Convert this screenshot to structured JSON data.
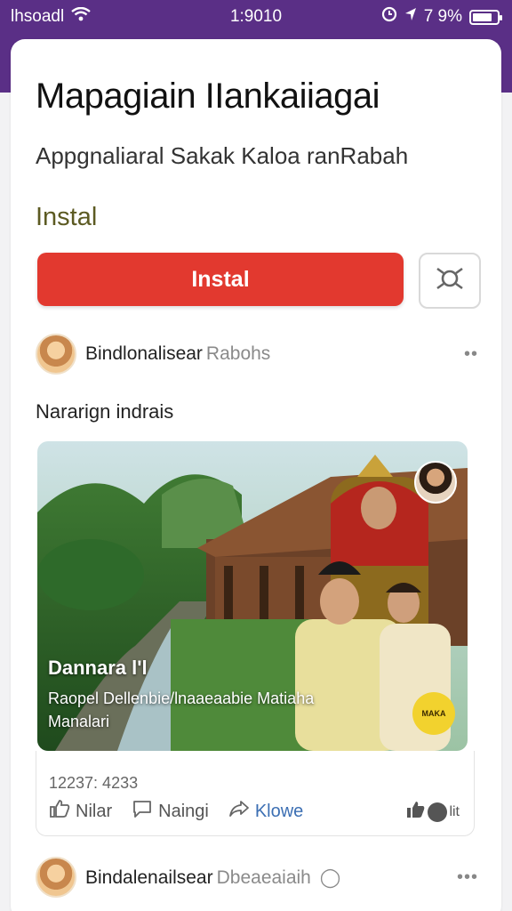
{
  "status": {
    "carrier": "lhsoadl",
    "time": "1:9010",
    "battery": "7 9%",
    "battery_level": 0.8
  },
  "app": {
    "title": "Mapagiain IIankaiiagai",
    "subtitle": "Appgnaliaral Sakak Kaloa ranRabah",
    "install_heading": "Instal",
    "install_button": "Instal"
  },
  "post": {
    "author": "Bindlonalisear",
    "author_extra": "Rabohs",
    "text": "Nararign indrais",
    "caption_title": "Dannara l'l",
    "caption_line1": "Raopel Dellenbie/lnaaeaabie Matiaha",
    "caption_line2": "Manalari",
    "badge": "MAKA",
    "stats": "12237: 4233",
    "like_label": "Nilar",
    "comment_label": "Naingi",
    "share_label": "Klowe",
    "reaction_count": "lit"
  },
  "post2": {
    "author": "Bindalenailsear",
    "author_extra": "Dbeaeaiaih"
  },
  "colors": {
    "status_bar": "#5a2f86",
    "install_button": "#e2392f",
    "install_label": "#5c5a22",
    "share_action": "#3c6fb3"
  },
  "icons": {
    "wifi": "wifi-icon",
    "alarm": "alarm-icon",
    "location": "location-icon",
    "battery": "battery-icon",
    "share_app": "share-icon",
    "like": "thumbs-up-icon",
    "comment": "comment-icon",
    "share_post": "share-arrow-icon",
    "more": "more-dots-icon"
  }
}
